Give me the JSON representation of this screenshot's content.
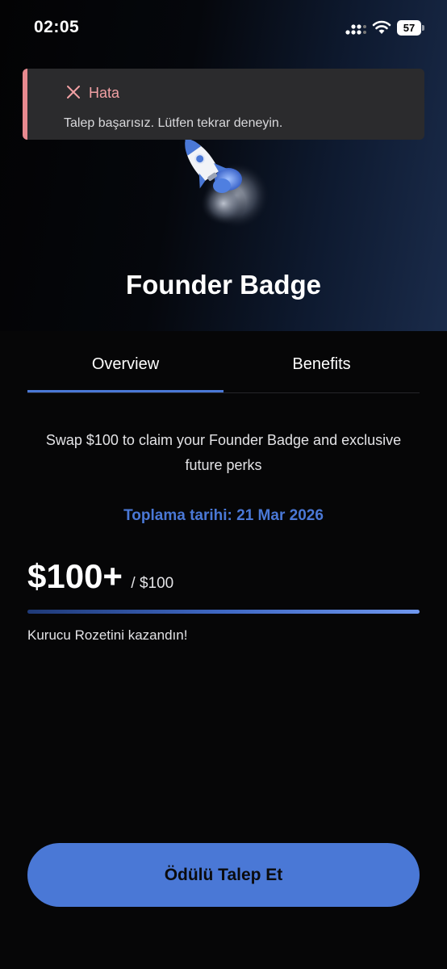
{
  "status_bar": {
    "time": "02:05",
    "battery_level": "57",
    "icons": [
      "signal-icon",
      "wifi-icon",
      "battery-icon"
    ]
  },
  "toast": {
    "icon": "close-icon",
    "title": "Hata",
    "message": "Talep başarısız. Lütfen tekrar deneyin.",
    "accent_color": "#e8898f"
  },
  "hero": {
    "illustration": "rocket-icon",
    "title": "Founder Badge"
  },
  "tabs": [
    {
      "label": "Overview",
      "active": true
    },
    {
      "label": "Benefits",
      "active": false
    }
  ],
  "overview": {
    "description": "Swap $100 to claim your Founder Badge and exclusive future perks",
    "collection_date": "Toplama tarihi: 21 Mar 2026",
    "amount": "$100+",
    "target": "/ $100",
    "progress": 1.0,
    "progress_message": "Kurucu Rozetini kazandın!"
  },
  "claim_button": {
    "label": "Ödülü Talep Et"
  },
  "colors": {
    "accent": "#4a78d6",
    "background": "#060607",
    "toast_background": "#2b2b2d"
  }
}
